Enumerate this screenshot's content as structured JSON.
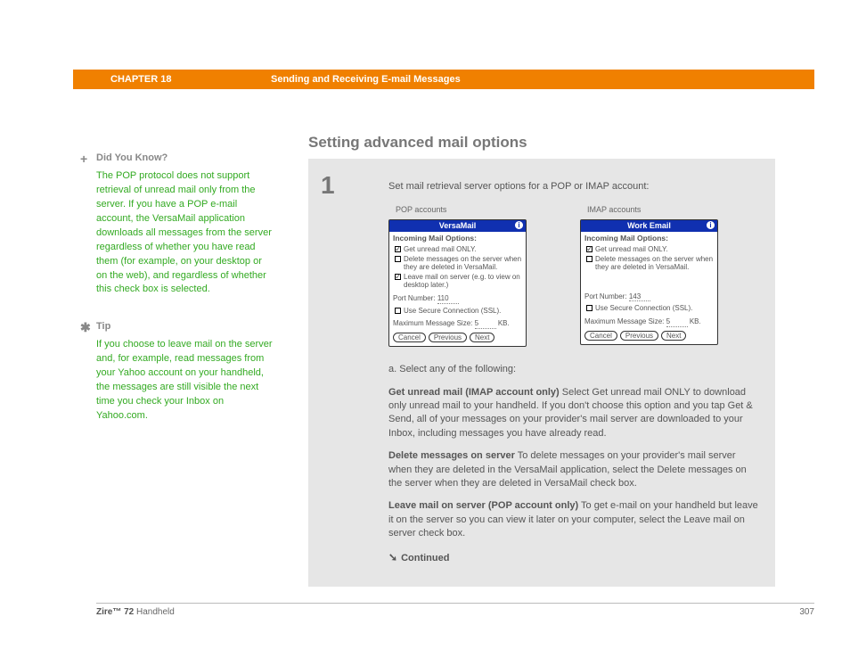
{
  "header": {
    "chapter": "CHAPTER 18",
    "title": "Sending and Receiving E-mail Messages"
  },
  "section_title": "Setting advanced mail options",
  "sidebar": {
    "didyouknow": {
      "heading": "Did You Know?",
      "body": "The POP protocol does not support retrieval of unread mail only from the server. If you have a POP e-mail account, the VersaMail application downloads all messages from the server regardless of whether you have read them (for example, on your desktop or on the web), and regardless of whether this check box is selected."
    },
    "tip": {
      "heading": "Tip",
      "body": "If you choose to leave mail on the server and, for example, read messages from your Yahoo account on your handheld, the messages are still visible the next time you check your Inbox on Yahoo.com."
    }
  },
  "step": {
    "number": "1",
    "intro": "Set mail retrieval server options for a POP or IMAP account:",
    "pop_label": "POP accounts",
    "imap_label": "IMAP accounts",
    "pop": {
      "title": "VersaMail",
      "subtitle": "Incoming Mail Options:",
      "opt1": "Get unread mail ONLY.",
      "opt2": "Delete messages on the server when they are deleted in VersaMail.",
      "opt3": "Leave mail on server (e.g. to view on desktop later.)",
      "port_label": "Port Number:",
      "port": "110",
      "ssl": "Use Secure Connection (SSL).",
      "maxsize_label": "Maximum Message Size:",
      "maxsize_val": "5",
      "maxsize_unit": "KB.",
      "btn_cancel": "Cancel",
      "btn_prev": "Previous",
      "btn_next": "Next"
    },
    "imap": {
      "title": "Work Email",
      "subtitle": "Incoming Mail Options:",
      "opt1": "Get unread mail ONLY.",
      "opt2": "Delete messages on the server when they are deleted in VersaMail.",
      "port_label": "Port Number:",
      "port": "143",
      "ssl": "Use Secure Connection (SSL).",
      "maxsize_label": "Maximum Message Size:",
      "maxsize_val": "5",
      "maxsize_unit": "KB.",
      "btn_cancel": "Cancel",
      "btn_prev": "Previous",
      "btn_next": "Next"
    },
    "list_a": "a.  Select any of the following:",
    "para1_bold": "Get unread mail (IMAP account only)",
    "para1": "   Select Get unread mail ONLY to download only unread mail to your handheld. If you don't choose this option and you tap Get & Send, all of your messages on your provider's mail server are downloaded to your Inbox, including messages you have already read.",
    "para2_bold": "Delete messages on server",
    "para2": "   To delete messages on your provider's mail server when they are deleted in the VersaMail application, select the Delete messages on the server when they are deleted in VersaMail check box.",
    "para3_bold": "Leave mail on server (POP account only)",
    "para3": "   To get e-mail on your handheld but leave it on the server so you can view it later on your computer, select the Leave mail on server check box.",
    "continued": "Continued"
  },
  "footer": {
    "product_bold": "Zire™ 72",
    "product_rest": " Handheld",
    "page": "307"
  }
}
